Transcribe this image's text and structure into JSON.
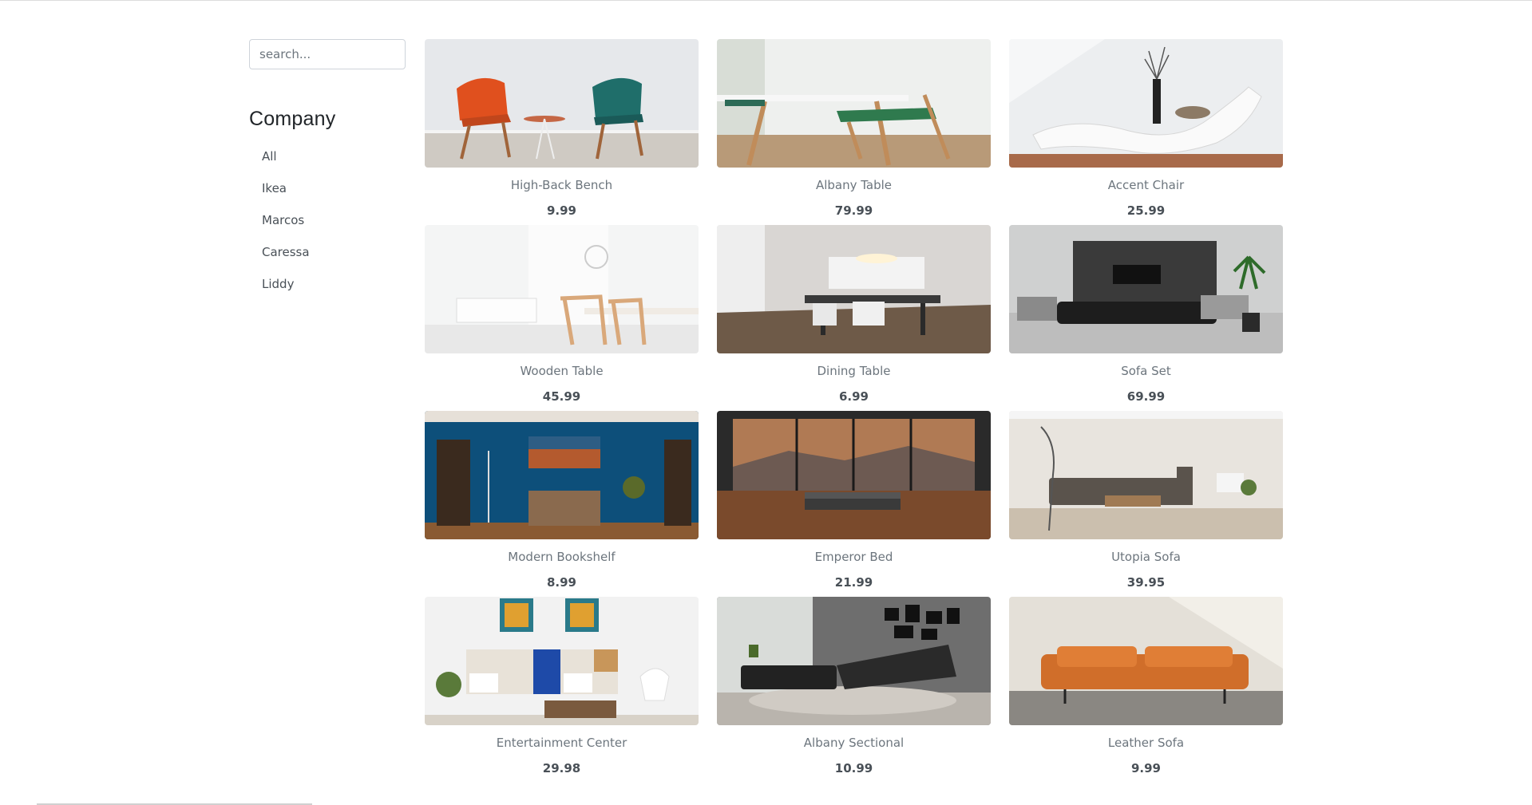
{
  "search": {
    "placeholder": "search..."
  },
  "sidebar": {
    "title": "Company",
    "items": [
      {
        "label": "All"
      },
      {
        "label": "Ikea"
      },
      {
        "label": "Marcos"
      },
      {
        "label": "Caressa"
      },
      {
        "label": "Liddy"
      }
    ]
  },
  "products": [
    {
      "name": "High-Back Bench",
      "price": "9.99",
      "image": "two-patterned-chairs-photo"
    },
    {
      "name": "Albany Table",
      "price": "79.99",
      "image": "white-table-with-chair-photo"
    },
    {
      "name": "Accent Chair",
      "price": "25.99",
      "image": "white-chaise-lounge-photo"
    },
    {
      "name": "Wooden Table",
      "price": "45.99",
      "image": "bright-dining-room-photo"
    },
    {
      "name": "Dining Table",
      "price": "6.99",
      "image": "dining-room-table-photo"
    },
    {
      "name": "Sofa Set",
      "price": "69.99",
      "image": "grey-living-room-photo"
    },
    {
      "name": "Modern Bookshelf",
      "price": "8.99",
      "image": "blue-wall-bookshelf-room-photo"
    },
    {
      "name": "Emperor Bed",
      "price": "21.99",
      "image": "bed-with-panoramic-window-photo"
    },
    {
      "name": "Utopia Sofa",
      "price": "39.95",
      "image": "sectional-sofa-living-room-photo"
    },
    {
      "name": "Entertainment Center",
      "price": "29.98",
      "image": "shelf-unit-with-paintings-photo"
    },
    {
      "name": "Albany Sectional",
      "price": "10.99",
      "image": "black-leather-sectional-photo"
    },
    {
      "name": "Leather Sofa",
      "price": "9.99",
      "image": "orange-leather-sofa-photo"
    }
  ]
}
